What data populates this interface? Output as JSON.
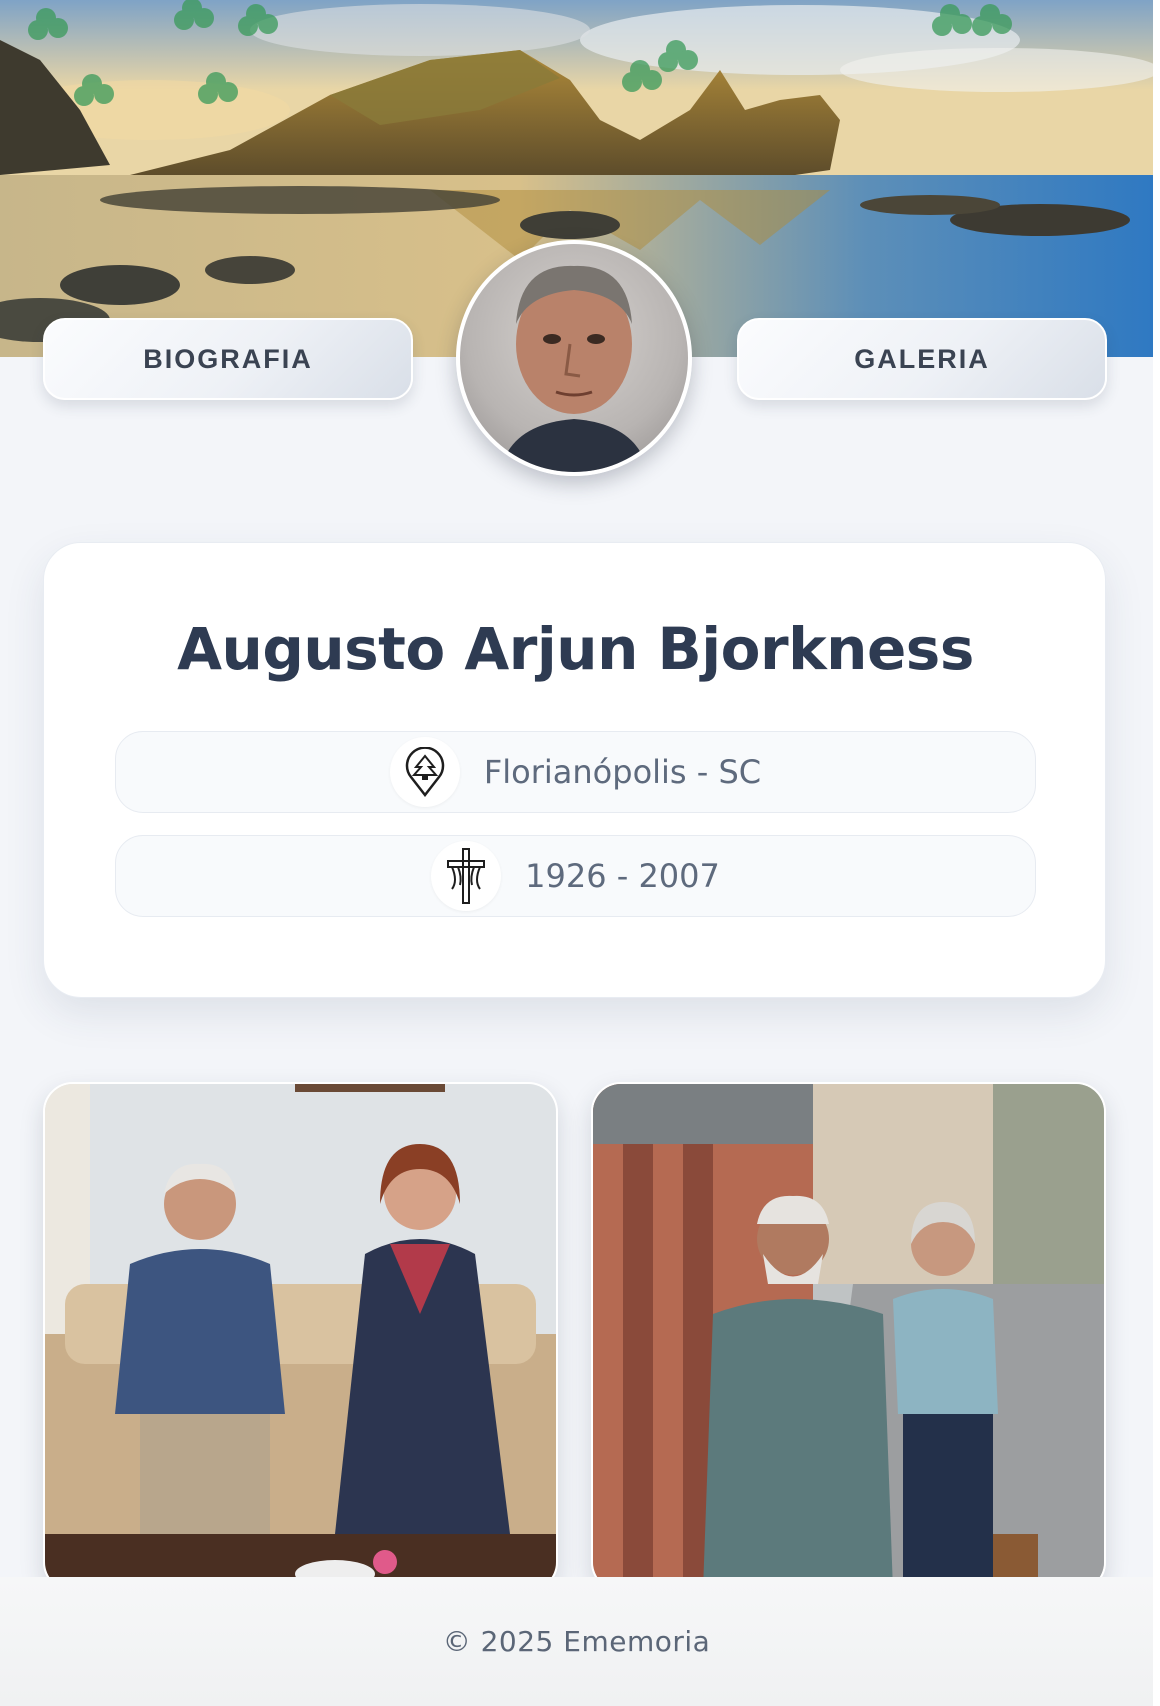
{
  "nav": {
    "left_label": "BIOGRAFIA",
    "right_label": "GALERIA"
  },
  "profile": {
    "name": "Augusto Arjun Bjorkness",
    "location": "Florianópolis - SC",
    "dates": "1926 - 2007"
  },
  "icons": {
    "location": "location-pin-tree-icon",
    "dates": "cross-icon",
    "decoration": "clover-icon"
  },
  "gallery": {
    "photos": [
      {
        "subject": "elderly couple seated on sofa"
      },
      {
        "subject": "elderly couple walking on street"
      }
    ]
  },
  "footer": {
    "copyright": "© 2025 Ememoria"
  },
  "colors": {
    "heading": "#2e3b52",
    "muted_text": "#5e6a7d",
    "background": "#f3f5f9",
    "card": "#ffffff"
  }
}
